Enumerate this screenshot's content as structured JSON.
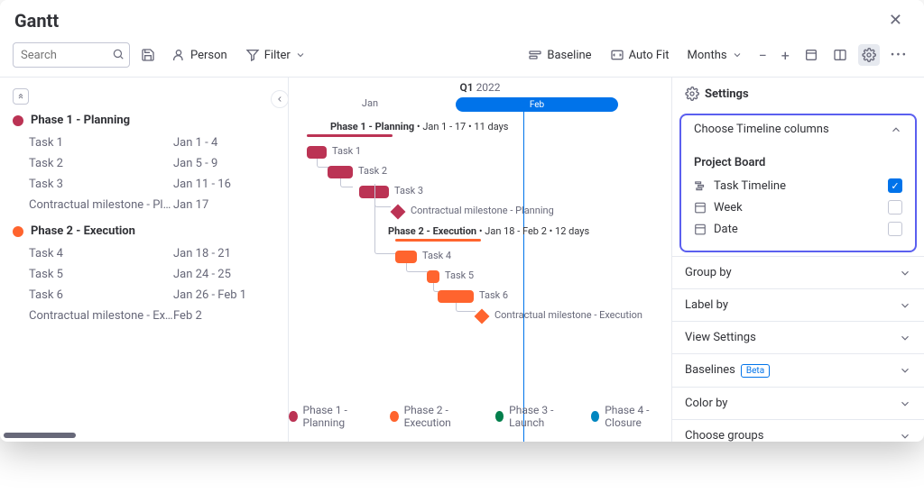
{
  "title": "Gantt",
  "toolbar": {
    "search_placeholder": "Search",
    "person_label": "Person",
    "filter_label": "Filter",
    "baseline_label": "Baseline",
    "autofit_label": "Auto Fit",
    "zoom_label": "Months"
  },
  "timeline": {
    "quarter_prefix": "Q1",
    "quarter_year": "2022",
    "month1": "Jan",
    "month2": "Feb",
    "phase1_summary_name": "Phase 1 - Planning",
    "phase1_summary_range": "Jan 1 - 17",
    "phase1_summary_dur": "11 days",
    "phase2_summary_name": "Phase 2 - Execution",
    "phase2_summary_range": "Jan 18 - Feb 2",
    "phase2_summary_dur": "12 days"
  },
  "tasks": {
    "phase1_title": "Phase 1 - Planning",
    "t1_name": "Task 1",
    "t1_dates": "Jan 1 - 4",
    "t2_name": "Task 2",
    "t2_dates": "Jan 5 - 9",
    "t3_name": "Task 3",
    "t3_dates": "Jan 11 - 16",
    "m1_name": "Contractual milestone - Planning",
    "m1_dates": "Jan 17",
    "phase2_title": "Phase 2 - Execution",
    "t4_name": "Task 4",
    "t4_dates": "Jan 18 - 21",
    "t5_name": "Task 5",
    "t5_dates": "Jan 24 - 25",
    "t6_name": "Task 6",
    "t6_dates": "Jan 26 - Feb 1",
    "m2_name": "Contractual milestone - Execution",
    "m2_dates": "Feb 2"
  },
  "legend": {
    "l1": "Phase 1 - Planning",
    "l2": "Phase 2 - Execution",
    "l3": "Phase 3 - Launch",
    "l4": "Phase 4 - Closure"
  },
  "settings": {
    "title": "Settings",
    "sec_columns": "Choose Timeline columns",
    "col_group": "Project Board",
    "col1": "Task Timeline",
    "col2": "Week",
    "col3": "Date",
    "sec_groupby": "Group by",
    "sec_labelby": "Label by",
    "sec_view": "View Settings",
    "sec_baselines": "Baselines",
    "beta": "Beta",
    "sec_colorby": "Color by",
    "sec_groups": "Choose groups"
  }
}
